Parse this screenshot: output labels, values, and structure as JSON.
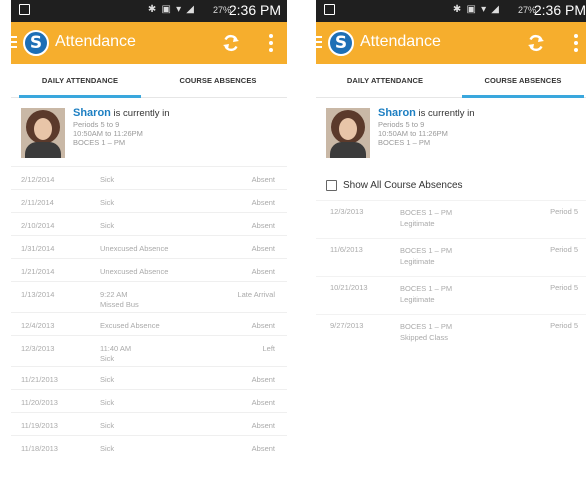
{
  "status_bar": {
    "icons": "✱ ▣ ▾ ◢",
    "battery": "27%",
    "time": "2:36 PM"
  },
  "app": {
    "title": "Attendance",
    "logo_letter": "S",
    "accent_color": "#f6ae2d",
    "brand_color": "#1d6fb6"
  },
  "tabs": [
    {
      "label": "DAILY ATTENDANCE"
    },
    {
      "label": "COURSE ABSENCES"
    }
  ],
  "student": {
    "name": "Sharon",
    "status_text": " is currently in",
    "periods": "Periods 5 to 9",
    "times": "10:50AM to 11:26PM",
    "location": "BOCES 1 – PM"
  },
  "daily_attendance": [
    {
      "date": "2/12/2014",
      "description": "Sick",
      "note": "",
      "status": "Absent"
    },
    {
      "date": "2/11/2014",
      "description": "Sick",
      "note": "",
      "status": "Absent"
    },
    {
      "date": "2/10/2014",
      "description": "Sick",
      "note": "",
      "status": "Absent"
    },
    {
      "date": "1/31/2014",
      "description": "Unexcused Absence",
      "note": "",
      "status": "Absent"
    },
    {
      "date": "1/21/2014",
      "description": "Unexcused Absence",
      "note": "",
      "status": "Absent"
    },
    {
      "date": "1/13/2014",
      "description": "9:22 AM",
      "note": "Missed Bus",
      "status": "Late Arrival"
    },
    {
      "date": "12/4/2013",
      "description": "Excused Absence",
      "note": "",
      "status": "Absent"
    },
    {
      "date": "12/3/2013",
      "description": "11:40 AM",
      "note": "Sick",
      "status": "Left"
    },
    {
      "date": "11/21/2013",
      "description": "Sick",
      "note": "",
      "status": "Absent"
    },
    {
      "date": "11/20/2013",
      "description": "Sick",
      "note": "",
      "status": "Absent"
    },
    {
      "date": "11/19/2013",
      "description": "Sick",
      "note": "",
      "status": "Absent"
    },
    {
      "date": "11/18/2013",
      "description": "Sick",
      "note": "",
      "status": "Absent"
    }
  ],
  "course_absences": {
    "show_all_label": "Show All Course Absences",
    "show_all_checked": false,
    "rows": [
      {
        "date": "12/3/2013",
        "course": "BOCES 1 – PM",
        "reason": "Legitimate",
        "period": "Period 5"
      },
      {
        "date": "11/6/2013",
        "course": "BOCES 1 – PM",
        "reason": "Legitimate",
        "period": "Period 5"
      },
      {
        "date": "10/21/2013",
        "course": "BOCES 1 – PM",
        "reason": "Legitimate",
        "period": "Period 5"
      },
      {
        "date": "9/27/2013",
        "course": "BOCES 1 – PM",
        "reason": "Skipped Class",
        "period": "Period 5"
      }
    ]
  }
}
